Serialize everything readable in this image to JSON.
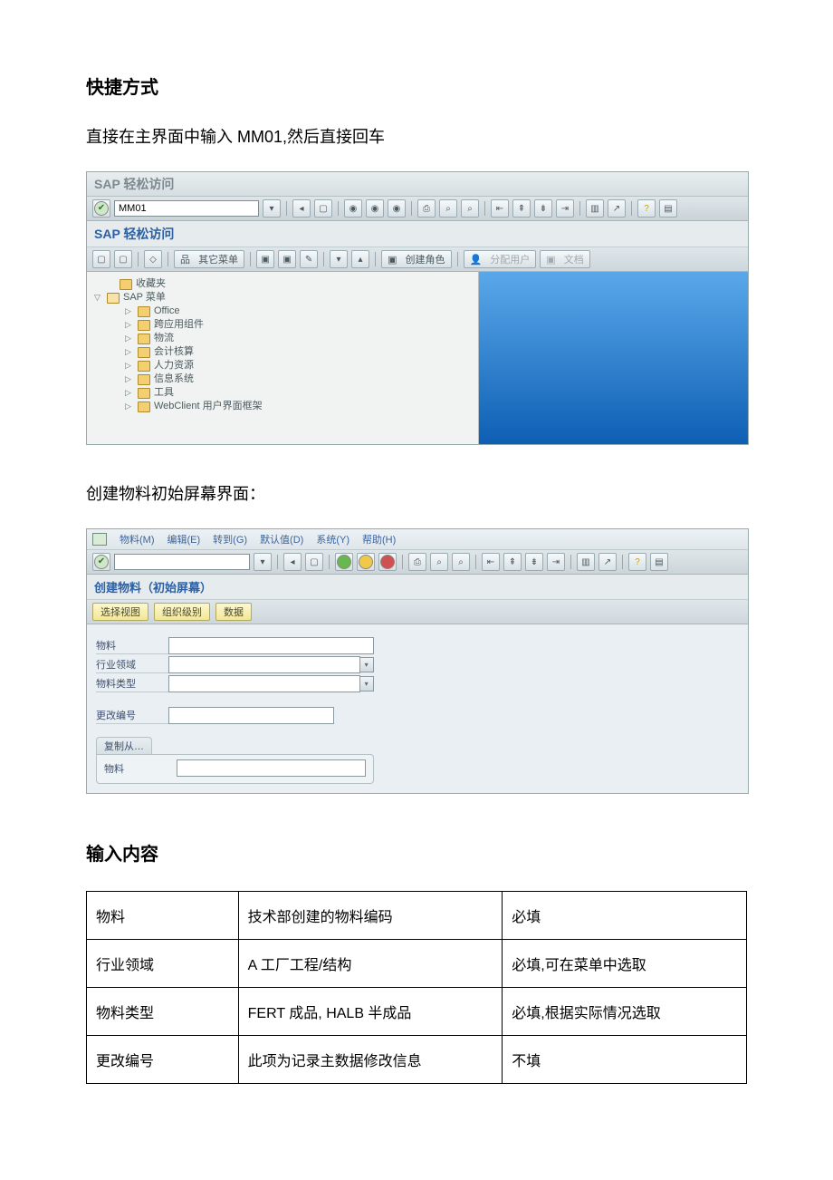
{
  "heading_shortcut": "快捷方式",
  "desc_shortcut": "直接在主界面中输入 MM01,然后直接回车",
  "sap1": {
    "title": "SAP 轻松访问",
    "tcode_value": "MM01",
    "subtitle": "SAP 轻松访问",
    "toolbar": {
      "other_menu": "其它菜单",
      "create_role": "创建角色",
      "assign_user": "分配用户",
      "doc": "文档"
    },
    "tree": {
      "favorites": "收藏夹",
      "sap_menu": "SAP 菜单",
      "items": [
        "Office",
        "跨应用组件",
        "物流",
        "会计核算",
        "人力资源",
        "信息系统",
        "工具",
        "WebClient 用户界面框架"
      ]
    }
  },
  "heading_createmat": "创建物料初始屏幕界面：",
  "sap2": {
    "menu": {
      "material": "物料(M)",
      "edit": "编辑(E)",
      "goto": "转到(G)",
      "defaults": "默认值(D)",
      "system": "系统(Y)",
      "help": "帮助(H)"
    },
    "subtitle": "创建物料（初始屏幕）",
    "toolbar": {
      "select_view": "选择视图",
      "org_level": "组织级别",
      "data": "数据"
    },
    "form": {
      "material": "物料",
      "industry": "行业领域",
      "mat_type": "物料类型",
      "change_no": "更改编号",
      "copy_from": "复制从…",
      "copy_material": "物料"
    }
  },
  "heading_input": "输入内容",
  "input_table": [
    {
      "f": "物料",
      "v": "技术部创建的物料编码",
      "r": "必填"
    },
    {
      "f": "行业领域",
      "v": "A 工厂工程/结构",
      "r": "必填,可在菜单中选取"
    },
    {
      "f": "物料类型",
      "v": "FERT  成品, HALB  半成品",
      "r": "必填,根据实际情况选取"
    },
    {
      "f": "更改编号",
      "v": "此项为记录主数据修改信息",
      "r": "不填"
    }
  ]
}
